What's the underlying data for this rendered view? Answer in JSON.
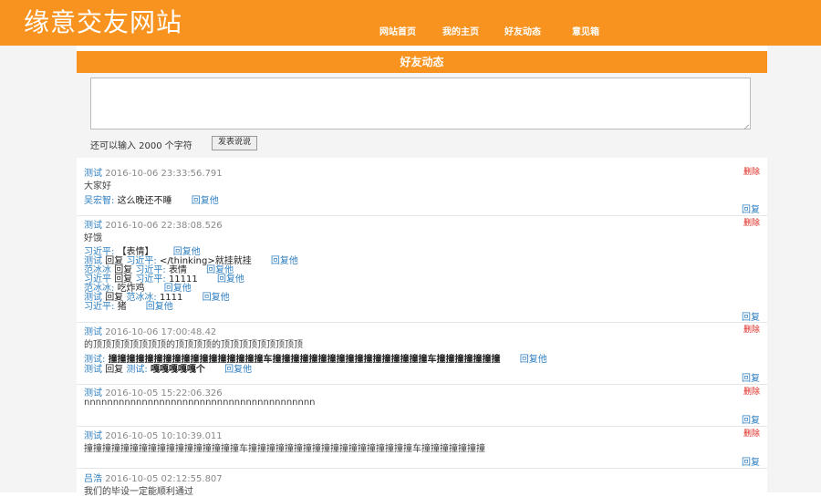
{
  "site": {
    "logo": "缘意交友网站"
  },
  "nav": [
    "网站首页",
    "我的主页",
    "好友动态",
    "意见箱"
  ],
  "section_title": "好友动态",
  "composer": {
    "remaining": "还可以输入 2000 个字符",
    "submit": "发表说说"
  },
  "delete_label": "删除",
  "reply_label": "回复",
  "reply_to_label": "回复他",
  "replied_word": "回复",
  "posts": [
    {
      "author": "测试",
      "time": "2016-10-06 23:33:56.791",
      "content": "大家好",
      "comments": [
        {
          "u1": "吴宏智:",
          "text": "这么晚还不睡"
        }
      ]
    },
    {
      "author": "测试",
      "time": "2016-10-06 22:38:08.526",
      "content": "好饿",
      "comments": [
        {
          "u1": "习近平:",
          "text": "【表情】"
        },
        {
          "u1": "测试",
          "u2": "习近平:",
          "text": "</thinking>就挂就挂"
        },
        {
          "u1": "范冰冰",
          "u2": "习近平:",
          "text": "表情"
        },
        {
          "u1": "习近平",
          "u2": "习近平:",
          "text": "11111"
        },
        {
          "u1": "范冰冰:",
          "text": "吃炸鸡"
        },
        {
          "u1": "测试",
          "u2": "范冰冰:",
          "text": "1111"
        },
        {
          "u1": "习近平:",
          "text": "猪"
        }
      ]
    },
    {
      "author": "测试",
      "time": "2016-10-06 17:00:48.42",
      "content": "的顶顶顶顶顶顶顶顶的顶顶顶顶的顶顶顶顶顶顶顶顶顶",
      "comments": [
        {
          "u1": "测试:",
          "text": "撞撞撞撞撞撞撞撞撞撞撞撞撞撞撞撞撞车撞撞撞撞撞撞撞撞撞撞撞撞撞撞撞撞撞车撞撞撞撞撞撞撞",
          "bold": true
        },
        {
          "u1": "测试",
          "u2": "测试:",
          "text": "嘎嘎嘎嘎嘎个",
          "bold": true
        }
      ]
    },
    {
      "author": "测试",
      "time": "2016-10-05 15:22:06.326",
      "content": "nnnnnnnnnnnnnnnnnnnnnnnnnnnnnnnnnnnnnnnn",
      "comments": []
    },
    {
      "author": "测试",
      "time": "2016-10-05 10:10:39.011",
      "content": "撞撞撞撞撞撞撞撞撞撞撞撞撞撞撞撞撞车撞撞撞撞撞撞撞撞撞撞撞撞撞撞撞撞撞撞车撞撞撞撞撞撞撞",
      "comments": []
    },
    {
      "author": "吕浩",
      "time": "2016-10-05 02:12:55.807",
      "content": "我们的毕设一定能顺利通过",
      "comments": []
    }
  ]
}
